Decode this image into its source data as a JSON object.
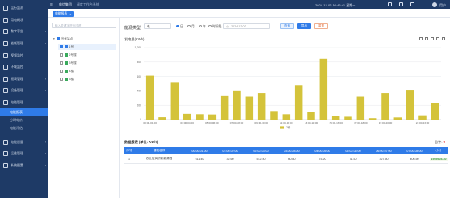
{
  "colors": {
    "sidebar": "#1e3a66",
    "accent": "#2f7be8",
    "bar": "#d4c33a",
    "total_red": "#e02424"
  },
  "topbar": {
    "breadcrumb1": "电信集团",
    "breadcrumb2": "调度工作台系统",
    "datetime": "2024-12-02 14:46:41 星期一",
    "user": "用户",
    "icons": [
      "dashboard-icon",
      "bell-icon",
      "question-icon",
      "user-icon"
    ]
  },
  "tab": {
    "label": "电能报表",
    "close": "×"
  },
  "sidebar": {
    "items": [
      {
        "label": "运行监测",
        "icon": "monitor-icon"
      },
      {
        "label": "用电概况",
        "icon": "overview-icon"
      },
      {
        "label": "数字孪生",
        "icon": "twin-icon",
        "chevron": "›"
      },
      {
        "label": "能耗管理",
        "icon": "energy-icon",
        "chevron": "›"
      },
      {
        "label": "视频监控",
        "icon": "video-icon"
      },
      {
        "label": "环境监控",
        "icon": "env-icon"
      },
      {
        "label": "报表管理",
        "icon": "report-icon",
        "chevron": "›"
      },
      {
        "label": "设备管理",
        "icon": "device-icon",
        "chevron": "›"
      },
      {
        "label": "电能管理",
        "icon": "power-icon",
        "chevron": "⌄"
      }
    ],
    "subitems": [
      {
        "label": "电能报表",
        "active": true
      },
      {
        "label": "分时电价",
        "active": false
      },
      {
        "label": "电能评估",
        "active": false
      }
    ],
    "items2": [
      {
        "label": "电能质量",
        "icon": "quality-icon",
        "chevron": "›"
      },
      {
        "label": "运维管理",
        "icon": "ops-icon",
        "chevron": "›"
      },
      {
        "label": "系统配置",
        "icon": "settings-icon",
        "chevron": "›"
      }
    ]
  },
  "tree": {
    "search_placeholder": "输入关键字进行过滤",
    "root": "光伏站点",
    "nodes": [
      {
        "label": "1号",
        "color": "#2f7be8",
        "checked": true
      },
      {
        "label": "2号楼",
        "color": "#3aaa5c",
        "checked": false
      },
      {
        "label": "3号楼",
        "color": "#3aaa5c",
        "checked": false
      },
      {
        "label": "4楼",
        "color": "#3aaa5c",
        "checked": false
      },
      {
        "label": "5楼",
        "color": "#3aaa5c",
        "checked": false
      }
    ]
  },
  "filters": {
    "type_label": "能源类型:",
    "type_value": "电",
    "period_options": [
      "日",
      "月",
      "年",
      "时间段"
    ],
    "period_selected": "日",
    "date_value": "2024-12-02",
    "query": "查询",
    "export": "导出",
    "reset": "重置"
  },
  "chart_title": "发电量(KWh)",
  "chart_data": {
    "type": "bar",
    "categories": [
      "00:00-01:00",
      "01:00-02:00",
      "02:00-03:00",
      "03:00-04:00",
      "04:00-05:00",
      "05:00-06:00",
      "06:00-07:00",
      "07:00-08:00",
      "08:00-09:00",
      "09:00-10:00",
      "10:00-11:00",
      "11:00-12:00",
      "12:00-13:00",
      "13:00-14:00",
      "14:00-15:00",
      "15:00-16:00",
      "16:00-17:00",
      "17:00-18:00",
      "18:00-19:00",
      "19:00-20:00",
      "20:00-21:00",
      "21:00-22:00",
      "22:00-23:00",
      "23:00-24:00"
    ],
    "values": [
      611.4,
      32.6,
      512.5,
      80.3,
      75.2,
      71.5,
      327.5,
      406.5,
      320.0,
      370.0,
      120.0,
      75.0,
      480.0,
      105.0,
      845.0,
      52.0,
      40.0,
      320.0,
      20.0,
      370.0,
      30.0,
      415.0,
      60.0,
      235.0
    ],
    "xtick_labels": [
      "00:00-01:00",
      "03:00-04:00",
      "05:00-06:00",
      "07:00-08:00",
      "09:00-10:00",
      "11:00-12:00",
      "13:00-14:00",
      "15:00-16:00",
      "17:00-18:00",
      "19:00-20:00",
      "22:00-23:00"
    ],
    "xtick_positions": [
      0,
      3,
      5,
      7,
      9,
      11,
      13,
      15,
      17,
      19,
      22
    ],
    "yticks": [
      0,
      200,
      400,
      600,
      800,
      1000
    ],
    "ylim": [
      0,
      1000
    ],
    "legend": "2号",
    "grid": true
  },
  "table": {
    "title": "数据报表 (单位: KWh)",
    "total_label": "总计:",
    "total_value": "0",
    "headers": [
      "序号",
      "建筑名称",
      "00:00-01:00",
      "01:00-02:00",
      "02:00-03:00",
      "03:00-04:00",
      "04:00-05:00",
      "05:00-06:00",
      "06:00-07:00",
      "07:00-08:00",
      "小计"
    ],
    "rows": [
      [
        "1",
        "农业航商贸新能源园",
        "611.40",
        "32.60",
        "512.50",
        "80.30",
        "75.20",
        "71.50",
        "327.50",
        "406.50",
        "1955904.40"
      ]
    ]
  }
}
